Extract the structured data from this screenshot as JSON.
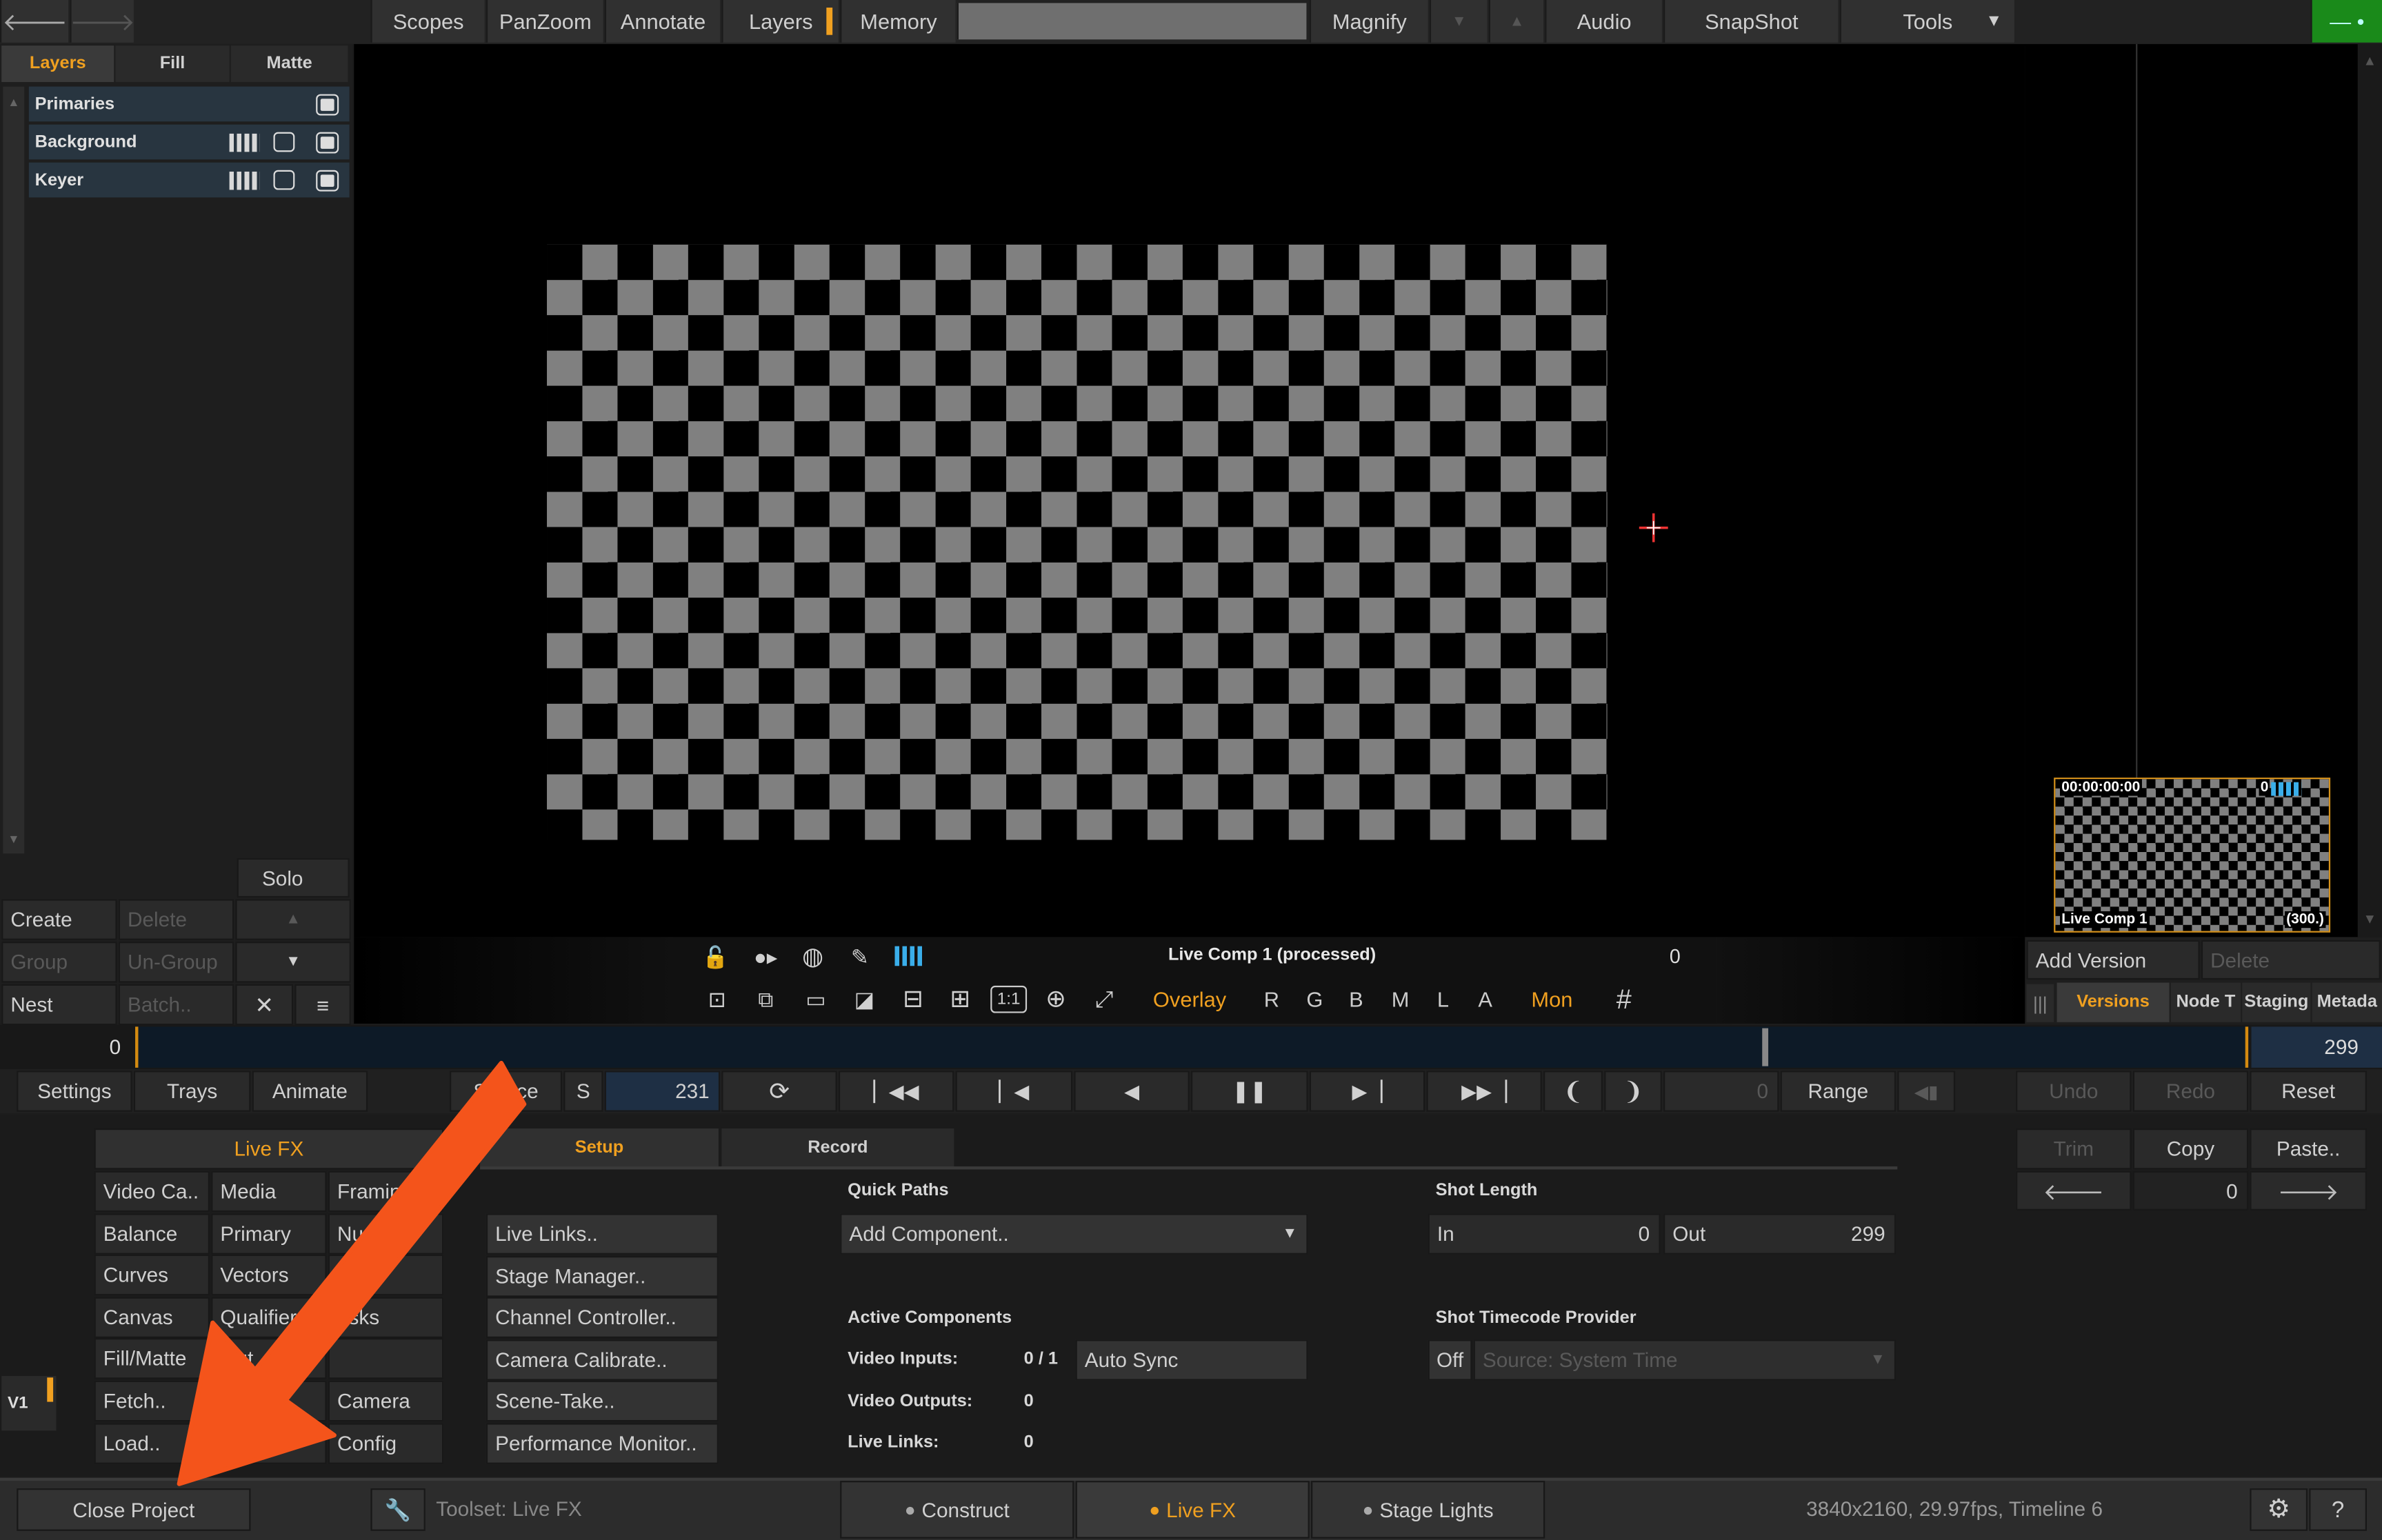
{
  "nav": {
    "back_icon": "back-arrow-icon",
    "forward_icon": "forward-arrow-icon"
  },
  "topbar": {
    "scopes": "Scopes",
    "panzoom": "PanZoom",
    "annotate": "Annotate",
    "layers": "Layers",
    "memory": "Memory",
    "magnify": "Magnify",
    "audio": "Audio",
    "snapshot": "SnapShot",
    "tools": "Tools"
  },
  "left_panel": {
    "tabs": {
      "layers": "Layers",
      "fill": "Fill",
      "matte": "Matte"
    },
    "rows": [
      {
        "label": "Primaries"
      },
      {
        "label": "Background"
      },
      {
        "label": "Keyer"
      }
    ],
    "solo": "Solo",
    "create": "Create",
    "delete": "Delete",
    "group": "Group",
    "ungroup": "Un-Group",
    "nest": "Nest",
    "batch": "Batch.."
  },
  "viewer": {
    "status_title": "Live Comp 1 (processed)",
    "status_value": "0",
    "overlay": "Overlay",
    "channels": [
      "R",
      "G",
      "B",
      "M",
      "L",
      "A"
    ],
    "mon": "Mon"
  },
  "thumbnail": {
    "timecode": "00:00:00:00",
    "index": "0",
    "name": "Live Comp 1",
    "frames": "(300.)"
  },
  "versions": {
    "add_version": "Add Version",
    "delete": "Delete",
    "tabs": [
      "Versions",
      "Node T",
      "Staging",
      "Metada"
    ]
  },
  "timeline": {
    "start": "0",
    "end": "299",
    "playhead_fraction": 0.76
  },
  "transport": {
    "settings": "Settings",
    "trays": "Trays",
    "animate": "Animate",
    "source": "Source",
    "s": "S",
    "frame": "231",
    "out_frame": "0",
    "range": "Range",
    "undo": "Undo",
    "redo": "Redo",
    "reset": "Reset"
  },
  "menu": {
    "title": "Live FX",
    "col1": [
      "Video Ca..",
      "Balance",
      "Curves",
      "Canvas",
      "Fill/Matte",
      "Fetch..",
      "Load.."
    ],
    "col2": [
      "Media",
      "Primary",
      "Vectors",
      "Qualifier",
      "Out",
      "",
      ""
    ],
    "col3": [
      "Framing",
      "Nu",
      "",
      "asks",
      "",
      "Camera",
      "Config"
    ]
  },
  "v1": "V1",
  "setup": {
    "tabs": {
      "setup": "Setup",
      "record": "Record"
    },
    "buttons": [
      "Live Links..",
      "Stage Manager..",
      "Channel Controller..",
      "Camera Calibrate..",
      "Scene-Take..",
      "Performance Monitor.."
    ],
    "quick_paths_label": "Quick Paths",
    "add_component": "Add Component..",
    "active_components_label": "Active Components",
    "video_inputs_label": "Video Inputs:",
    "video_inputs_value": "0 / 1",
    "auto_sync": "Auto Sync",
    "video_outputs_label": "Video Outputs:",
    "video_outputs_value": "0",
    "live_links_label": "Live Links:",
    "live_links_value": "0",
    "shot_length_label": "Shot Length",
    "in_label": "In",
    "in_value": "0",
    "out_label": "Out",
    "out_value": "299",
    "timecode_label": "Shot Timecode Provider",
    "off": "Off",
    "source": "Source: System Time"
  },
  "edit": {
    "trim": "Trim",
    "copy": "Copy",
    "paste": "Paste..",
    "value": "0"
  },
  "statusbar": {
    "close_project": "Close Project",
    "toolset": "Toolset: Live FX",
    "construct": "Construct",
    "livefx": "Live FX",
    "stagelights": "Stage Lights",
    "info": "3840x2160, 29.97fps, Timeline 6"
  },
  "colors": {
    "accent": "#f0a020",
    "arrow": "#f4541b",
    "selected_row": "#283540",
    "record_green": "#1a8a1a"
  }
}
